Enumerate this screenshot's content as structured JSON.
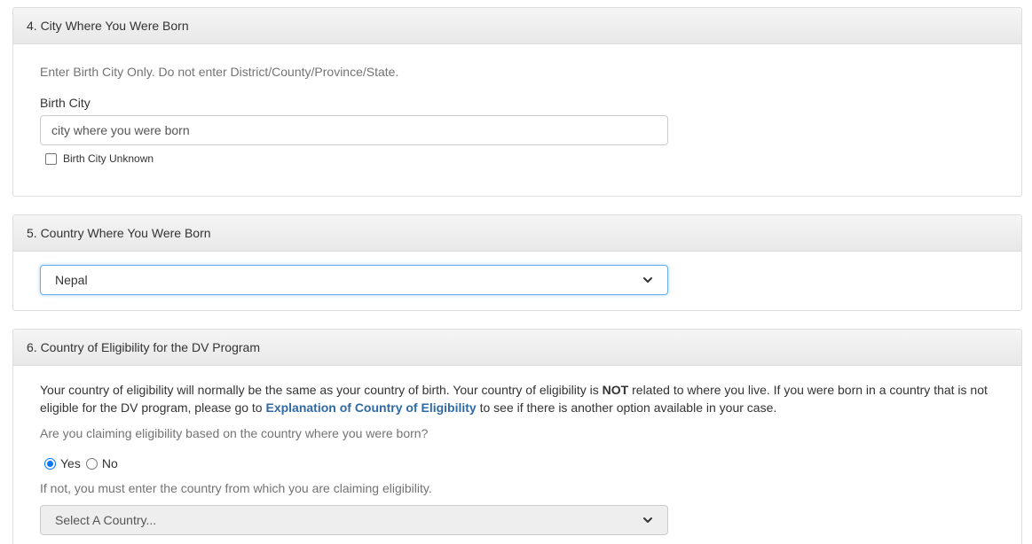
{
  "section4": {
    "heading": "4. City Where You Were Born",
    "instruction": "Enter Birth City Only. Do not enter District/County/Province/State.",
    "field_label": "Birth City",
    "input_value": "",
    "input_placeholder": "city where you were born",
    "unknown_checkbox_label": "Birth City Unknown",
    "unknown_checked": false
  },
  "section5": {
    "heading": "5. Country Where You Were Born",
    "selected_country": "Nepal"
  },
  "section6": {
    "heading": "6. Country of Eligibility for the DV Program",
    "para_part1": "Your country of eligibility will normally be the same as your country of birth. Your country of eligibility is ",
    "para_bold": "NOT",
    "para_part2": " related to where you live. If you were born in a country that is not eligible for the DV program, please go to ",
    "para_link": "Explanation of Country of Eligibility",
    "para_part3": " to see if there is another option available in your case.",
    "question": "Are you claiming eligibility based on the country where you were born?",
    "radio_yes_label": "Yes",
    "radio_no_label": "No",
    "selected_option": "Yes",
    "if_not_text": "If not, you must enter the country from which you are claiming eligibility.",
    "country_select_placeholder": "Select A Country..."
  },
  "icons": {
    "select_arrow": "chevron-down-icon"
  },
  "colors": {
    "link": "#2f6aa5",
    "focus_border": "#66afe9",
    "radio_checked": "#0075ff",
    "panel_heading_bg": "#f0f0f0"
  }
}
